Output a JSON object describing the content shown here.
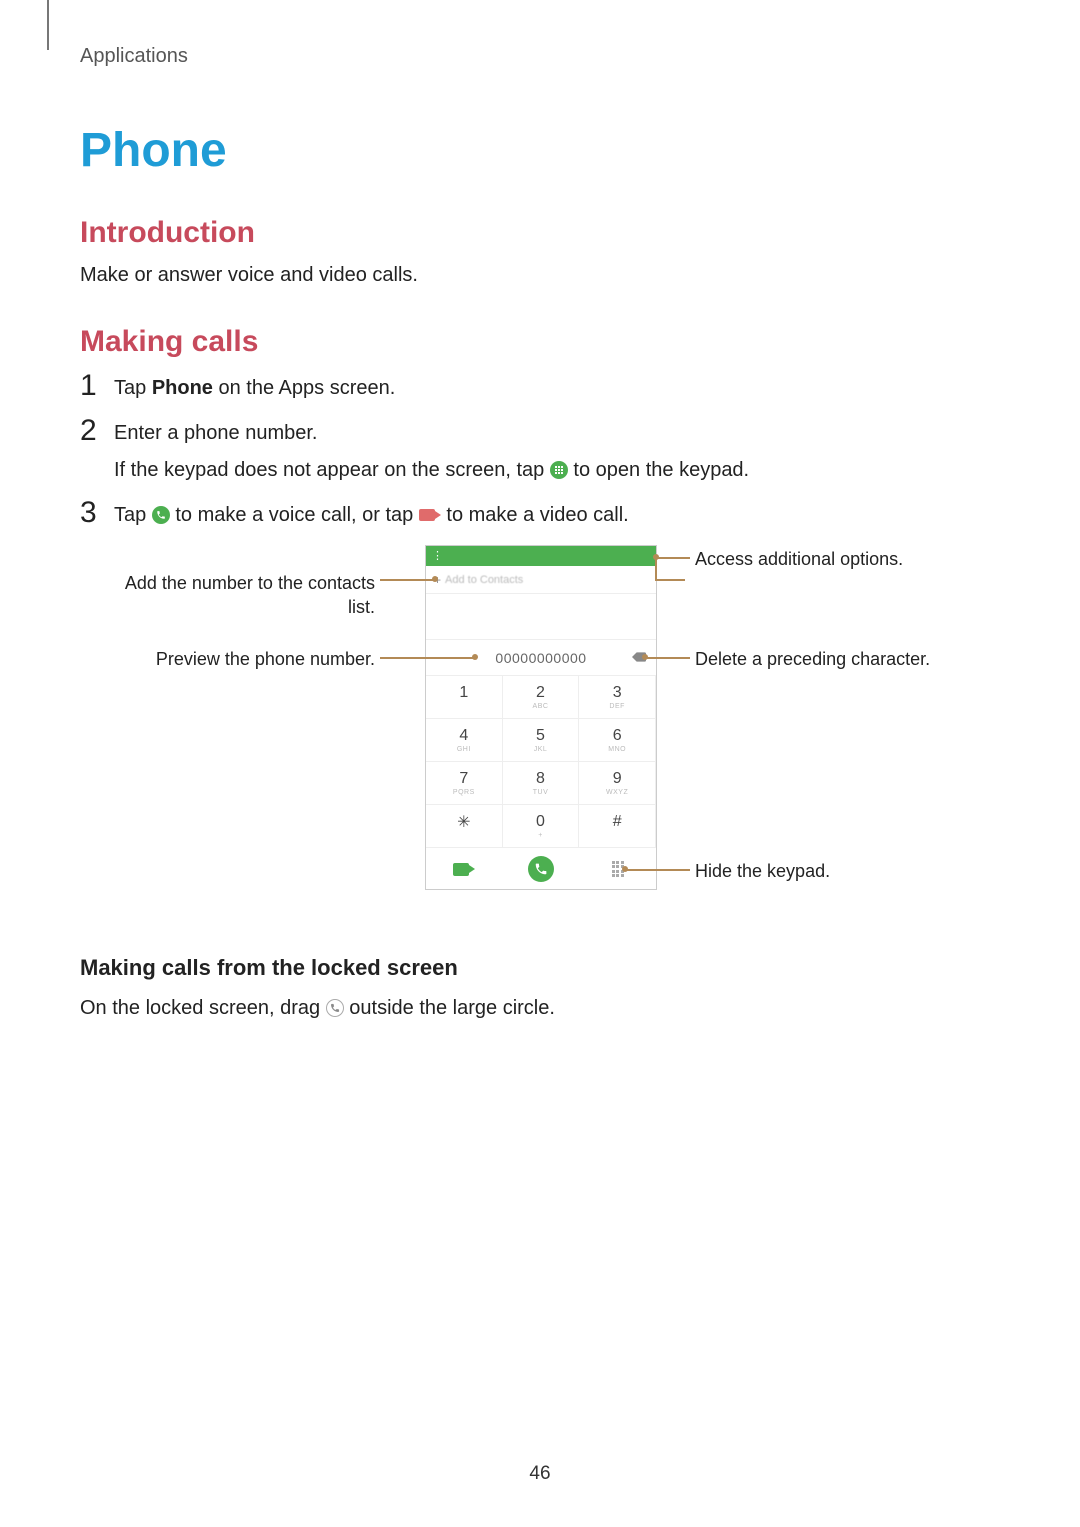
{
  "breadcrumb": "Applications",
  "h1": "Phone",
  "section_intro": {
    "heading": "Introduction",
    "text": "Make or answer voice and video calls."
  },
  "section_making": {
    "heading": "Making calls",
    "steps": {
      "s1": {
        "num": "1",
        "pre": "Tap ",
        "bold": "Phone",
        "post": " on the Apps screen."
      },
      "s2": {
        "num": "2",
        "line1": "Enter a phone number.",
        "line2a": "If the keypad does not appear on the screen, tap ",
        "line2b": " to open the keypad."
      },
      "s3": {
        "num": "3",
        "a": "Tap ",
        "b": " to make a voice call, or tap ",
        "c": " to make a video call."
      }
    }
  },
  "figure": {
    "menu_icon_label": "⋮",
    "add_contact_label": "Add to Contacts",
    "number_preview": "00000000000",
    "keys": {
      "k1": "1",
      "k2": "2",
      "k3": "3",
      "k4": "4",
      "k5": "5",
      "k6": "6",
      "k7": "7",
      "k8": "8",
      "k9": "9",
      "kstar": "✳",
      "k0": "0",
      "khash": "#"
    },
    "callouts": {
      "add": "Add the number to the contacts list.",
      "preview": "Preview the phone number.",
      "options": "Access additional options.",
      "delete": "Delete a preceding character.",
      "hide": "Hide the keypad."
    }
  },
  "section_locked": {
    "heading": "Making calls from the locked screen",
    "text_a": "On the locked screen, drag ",
    "text_b": " outside the large circle."
  },
  "page_number": "46"
}
